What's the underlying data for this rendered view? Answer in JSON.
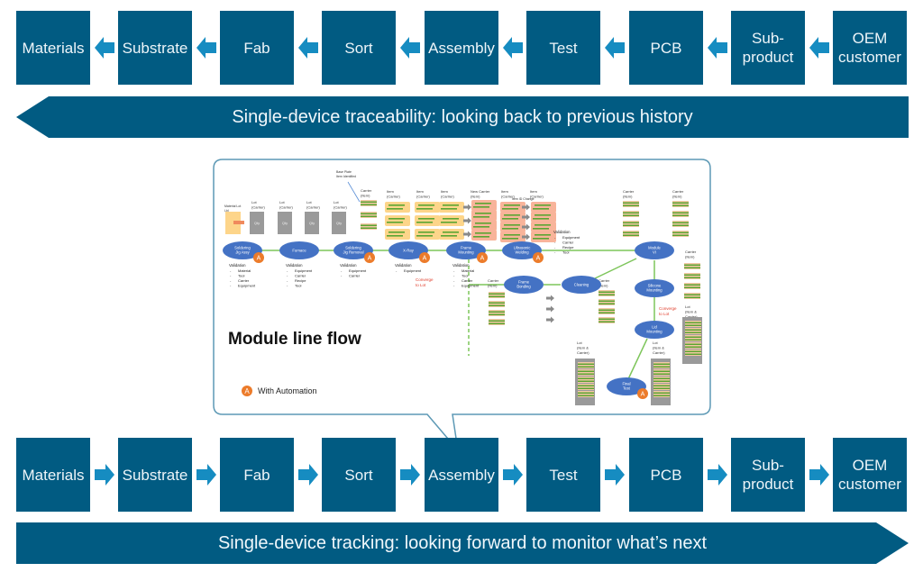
{
  "colors": {
    "box": "#015b82",
    "arrow": "#168cc1",
    "callout_border": "#5d99b5",
    "ellipse": "#4472c4",
    "automation": "#ec7b2a",
    "converge": "#e03c2a",
    "flow_line": "#7dc55a"
  },
  "top_row": {
    "direction": "backward",
    "stages": [
      "Materials",
      "Substrate",
      "Fab",
      "Sort",
      "Assembly",
      "Test",
      "PCB",
      "Sub-product",
      "OEM customer"
    ],
    "stage_lines": [
      [
        "Materials"
      ],
      [
        "Substrate"
      ],
      [
        "Fab"
      ],
      [
        "Sort"
      ],
      [
        "Assembly"
      ],
      [
        "Test"
      ],
      [
        "PCB"
      ],
      [
        "Sub-",
        "product"
      ],
      [
        "OEM",
        "customer"
      ]
    ],
    "banner": "Single-device traceability: looking back to previous history"
  },
  "bottom_row": {
    "direction": "forward",
    "stages": [
      "Materials",
      "Substrate",
      "Fab",
      "Sort",
      "Assembly",
      "Test",
      "PCB",
      "Sub-product",
      "OEM customer"
    ],
    "stage_lines": [
      [
        "Materials"
      ],
      [
        "Substrate"
      ],
      [
        "Fab"
      ],
      [
        "Sort"
      ],
      [
        "Assembly"
      ],
      [
        "Test"
      ],
      [
        "PCB"
      ],
      [
        "Sub-",
        "product"
      ],
      [
        "OEM",
        "customer"
      ]
    ],
    "banner": "Single-device tracking: looking forward to monitor what’s next"
  },
  "callout": {
    "title": "Module line flow",
    "legend_badge": "A",
    "legend_label": "With Automation",
    "points_to": "Assembly",
    "processes": [
      {
        "name": "Soldering Jig Assy",
        "lines": [
          "Soldering",
          "Jig Assy"
        ],
        "automation": true,
        "validation": [
          "Material",
          "Tool",
          "Carrier",
          "Equipment"
        ]
      },
      {
        "name": "Furnace",
        "lines": [
          "Furnace"
        ],
        "automation": false,
        "validation": [
          "Equipment",
          "Carrier",
          "Recipe",
          "Tool"
        ]
      },
      {
        "name": "Soldering Jig Removal",
        "lines": [
          "Soldering",
          "Jig Removal"
        ],
        "automation": true,
        "validation": [
          "Equipment",
          "Carrier"
        ]
      },
      {
        "name": "X-Ray",
        "lines": [
          "X-Ray"
        ],
        "automation": true,
        "validation": [
          "Equipment"
        ]
      },
      {
        "name": "Frame Mounting",
        "lines": [
          "Frame",
          "Mounting"
        ],
        "automation": true,
        "validation": [
          "Material",
          "Tool",
          "Carrier",
          "Equipment"
        ]
      },
      {
        "name": "Ultrasonic Welding",
        "lines": [
          "Ultrasonic",
          "Welding"
        ],
        "automation": true,
        "validation": [
          "Equipment",
          "Carrier",
          "Recipe",
          "Tool"
        ]
      },
      {
        "name": "Frame Bonding",
        "lines": [
          "Frame",
          "Bonding"
        ],
        "automation": false
      },
      {
        "name": "Cleaning",
        "lines": [
          "Cleaning"
        ],
        "automation": false
      },
      {
        "name": "Module VI",
        "lines": [
          "Module",
          "VI"
        ],
        "automation": false
      },
      {
        "name": "Silicone Mounting",
        "lines": [
          "Silicone",
          "Mounting"
        ],
        "automation": false
      },
      {
        "name": "Lid Mounting",
        "lines": [
          "Lid",
          "Mounting"
        ],
        "automation": false
      },
      {
        "name": "Final Test",
        "lines": [
          "Final",
          "Test"
        ],
        "automation": true
      }
    ],
    "validation_label": "Validation",
    "converge_label": [
      "Converge",
      "to Lot"
    ],
    "labels": {
      "material_lot": [
        "Material Lot",
        "Lbl"
      ],
      "lot_carrier": [
        "Lot",
        "(Carrier)"
      ],
      "qty": "Qty",
      "carrier_item": [
        "Carrier",
        "(Item)"
      ],
      "item_carrier": [
        "Item",
        "(Carrier)"
      ],
      "new_carrier": [
        "New Carrier",
        "(Item)"
      ],
      "item_id_change": "Item ID Change",
      "base_plate": [
        "Base Plate",
        "Item Identified"
      ],
      "lot_item_carrier": [
        "Lot",
        "(Item &",
        "Carrier)"
      ]
    }
  }
}
